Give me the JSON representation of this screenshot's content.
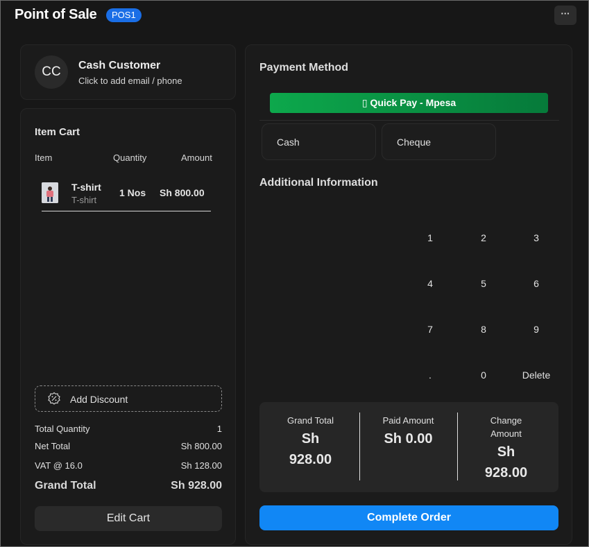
{
  "header": {
    "title": "Point of Sale",
    "badge": "POS1",
    "more_icon": "ellipsis-icon",
    "more_label": "···"
  },
  "customer": {
    "initials": "CC",
    "name": "Cash Customer",
    "subtitle": "Click to add email / phone"
  },
  "cart": {
    "title": "Item Cart",
    "columns": [
      "Item",
      "Quantity",
      "Amount"
    ],
    "items": [
      {
        "name": "T-shirt",
        "subtitle": "T-shirt",
        "quantity": "1 Nos",
        "amount": "Sh 800.00"
      }
    ],
    "discount_label": "Add Discount",
    "totals": {
      "total_quantity_label": "Total Quantity",
      "total_quantity": "1",
      "net_total_label": "Net Total",
      "net_total": "Sh 800.00",
      "vat_label": "VAT @ 16.0",
      "vat": "Sh 128.00",
      "grand_total_label": "Grand Total",
      "grand_total": "Sh 928.00"
    },
    "edit_label": "Edit Cart"
  },
  "payment": {
    "title": "Payment Method",
    "quick_pay": "▯ Quick Pay - Mpesa",
    "methods": [
      "Cash",
      "Cheque"
    ],
    "additional_title": "Additional Information",
    "keypad": [
      "1",
      "2",
      "3",
      "4",
      "5",
      "6",
      "7",
      "8",
      "9",
      ".",
      "0",
      "Delete"
    ],
    "summary": {
      "grand_total_label": "Grand Total",
      "grand_total_currency": "Sh",
      "grand_total_value": "928.00",
      "paid_label": "Paid Amount",
      "paid_value": "Sh 0.00",
      "change_label_1": "Change",
      "change_label_2": "Amount",
      "change_currency": "Sh",
      "change_value": "928.00"
    },
    "complete_label": "Complete Order"
  },
  "colors": {
    "accent": "#1187f5",
    "badge": "#1a6ee6",
    "mpesa_green": "#0da84c",
    "background": "#171717",
    "card": "#1b1b1b"
  }
}
